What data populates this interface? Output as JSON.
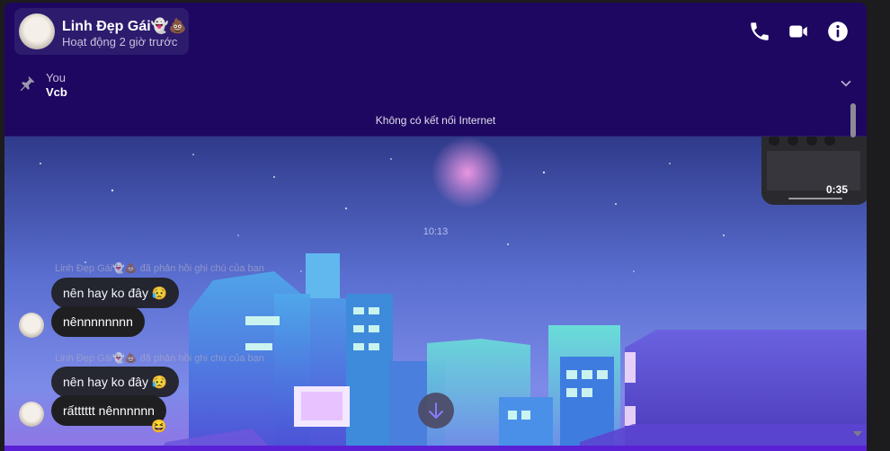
{
  "conversation": {
    "contact_name": "Linh Đẹp Gái👻💩",
    "status": "Hoạt động 2 giờ trước",
    "icons": [
      "phone-icon",
      "video-call-icon",
      "info-icon"
    ]
  },
  "pinned": {
    "author": "You",
    "text": "Vcb"
  },
  "network_status": "Không có kết nối Internet",
  "video_message": {
    "duration": "0:35"
  },
  "timestamp": "10:13",
  "messages": [
    {
      "reply_label": "Linh Đẹp Gái👻💩 đã phản hồi ghi chú của bạn",
      "quoted_note": "nên hay ko đây 😥",
      "text": "nênnnnnnnn"
    },
    {
      "reply_label": "Linh Đẹp Gái👻💩 đã phản hồi ghi chú của bạn",
      "quoted_note": "nên hay ko đây 😥",
      "text": "rấtttttt nênnnnnn",
      "reaction": "😆"
    }
  ],
  "colors": {
    "header_bg": "#1e0760",
    "bubble_bg": "#1f1f22",
    "accent": "#5a20d6"
  }
}
